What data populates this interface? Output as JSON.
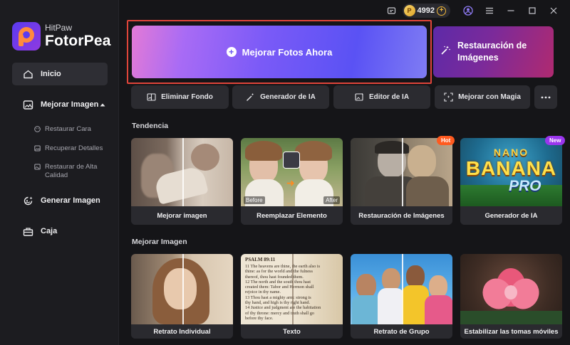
{
  "app": {
    "brand_small": "HitPaw",
    "brand_big": "FotorPea"
  },
  "header": {
    "coins": "4992"
  },
  "sidebar": {
    "items": [
      {
        "label": "Inicio"
      },
      {
        "label": "Mejorar Imagen"
      },
      {
        "label": "Generar Imagen"
      },
      {
        "label": "Caja"
      }
    ],
    "sub_items": [
      {
        "label": "Restaurar Cara"
      },
      {
        "label": "Recuperar Detalles"
      },
      {
        "label": "Restaurar de Alta Calidad"
      }
    ]
  },
  "hero": {
    "main_label": "Mejorar Fotos Ahora",
    "restore_label": "Restauración de Imágenes"
  },
  "tools": [
    {
      "label": "Eliminar Fondo"
    },
    {
      "label": "Generador de IA"
    },
    {
      "label": "Editor de IA"
    },
    {
      "label": "Mejorar con Magia"
    }
  ],
  "sections": {
    "trending": "Tendencia",
    "enhance": "Mejorar Imagen"
  },
  "trending_cards": [
    {
      "label": "Mejorar imagen"
    },
    {
      "label": "Reemplazar Elemento",
      "before": "Before",
      "after": "After"
    },
    {
      "label": "Restauración de Imágenes",
      "badge": "Hot"
    },
    {
      "label": "Generador de IA",
      "badge": "New",
      "art_line1": "NANO",
      "art_line2": "BANANA",
      "art_line3": "PRO"
    }
  ],
  "enhance_cards": [
    {
      "label": "Retrato Individual"
    },
    {
      "label": "Texto",
      "psalm": "PSALM 89:11",
      "text_lines": [
        "11 The heavens are thine, the earth also is",
        "thine: as for the world and the fulness",
        "thereof, thou hast founded them.",
        "12 The north and the south thou hast",
        "created them: Tabor and Hermon shall",
        "rejoice in thy name.",
        "13 Thou hast a mighty arm: strong is",
        "thy hand, and high is thy right hand.",
        "14 Justice and judgment are the habitation",
        "of thy throne: mercy and truth shall go",
        "before thy face."
      ]
    },
    {
      "label": "Retrato de Grupo"
    },
    {
      "label": "Estabilizar las tomas móviles"
    }
  ],
  "colors": {
    "accent_outline": "#e0453a",
    "hot": "#ff5a1f",
    "new": "#9a35ee",
    "background": "#151518"
  }
}
